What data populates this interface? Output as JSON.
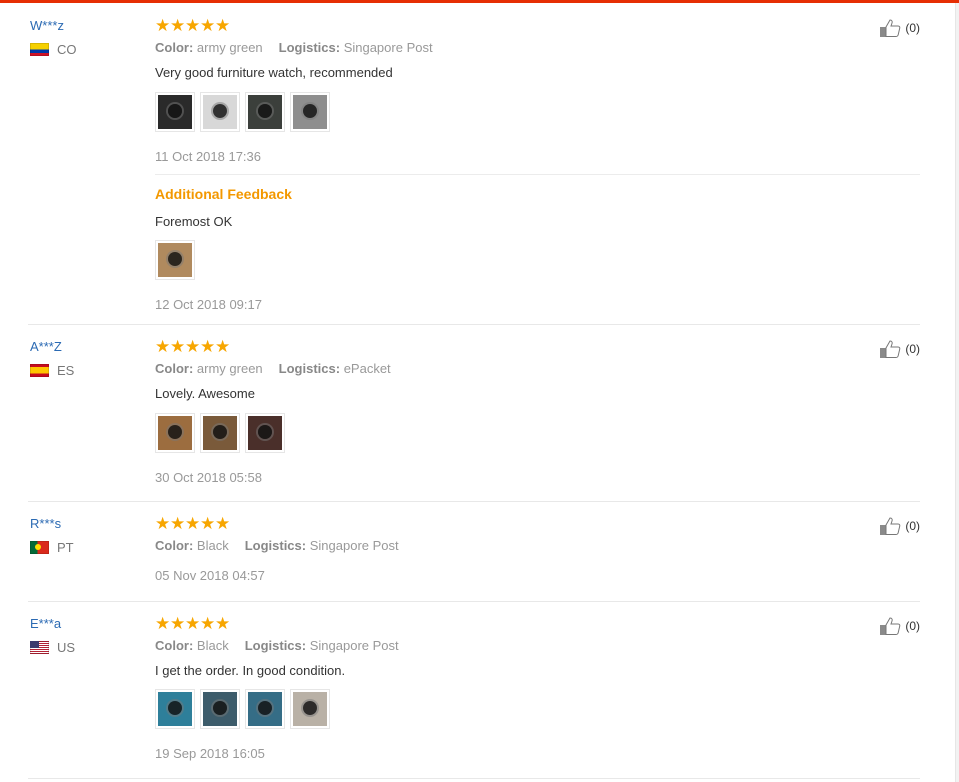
{
  "reviews": [
    {
      "user": "W***z",
      "country": "CO",
      "flag": "co",
      "color_label": "Color:",
      "color": "army green",
      "logistics_label": "Logistics:",
      "logistics": "Singapore Post",
      "text": "Very good furniture watch, recommended",
      "images": [
        "#2a2a2a",
        "#d8d8d8",
        "#3b3f3b",
        "#8e8e8e"
      ],
      "date": "11 Oct 2018 17:36",
      "additional": {
        "title": "Additional Feedback",
        "text": "Foremost OK",
        "images": [
          "#b08a5e"
        ],
        "date": "12 Oct 2018 09:17"
      },
      "likes": "(0)"
    },
    {
      "user": "A***Z",
      "country": "ES",
      "flag": "es",
      "color_label": "Color:",
      "color": "army green",
      "logistics_label": "Logistics:",
      "logistics": "ePacket",
      "text": "Lovely. Awesome",
      "images": [
        "#9c6d3f",
        "#7a5a3a",
        "#4a2f2a"
      ],
      "date": "30 Oct 2018 05:58",
      "likes": "(0)"
    },
    {
      "user": "R***s",
      "country": "PT",
      "flag": "pt",
      "color_label": "Color:",
      "color": "Black",
      "logistics_label": "Logistics:",
      "logistics": "Singapore Post",
      "date": "05 Nov 2018 04:57",
      "likes": "(0)"
    },
    {
      "user": "E***a",
      "country": "US",
      "flag": "us",
      "color_label": "Color:",
      "color": "Black",
      "logistics_label": "Logistics:",
      "logistics": "Singapore Post",
      "text": "I get the order. In good condition.",
      "images": [
        "#2e7f9a",
        "#3d5c6b",
        "#356d86",
        "#b9b1a6"
      ],
      "date": "19 Sep 2018 16:05",
      "likes": "(0)"
    }
  ],
  "icons": {
    "star": "star-icon",
    "like": "thumbs-up-icon",
    "rating": 5
  },
  "colors": {
    "accent": "#f39800",
    "star": "#f7a600",
    "username": "#2b6ab3",
    "topbar": "#e62e04"
  }
}
